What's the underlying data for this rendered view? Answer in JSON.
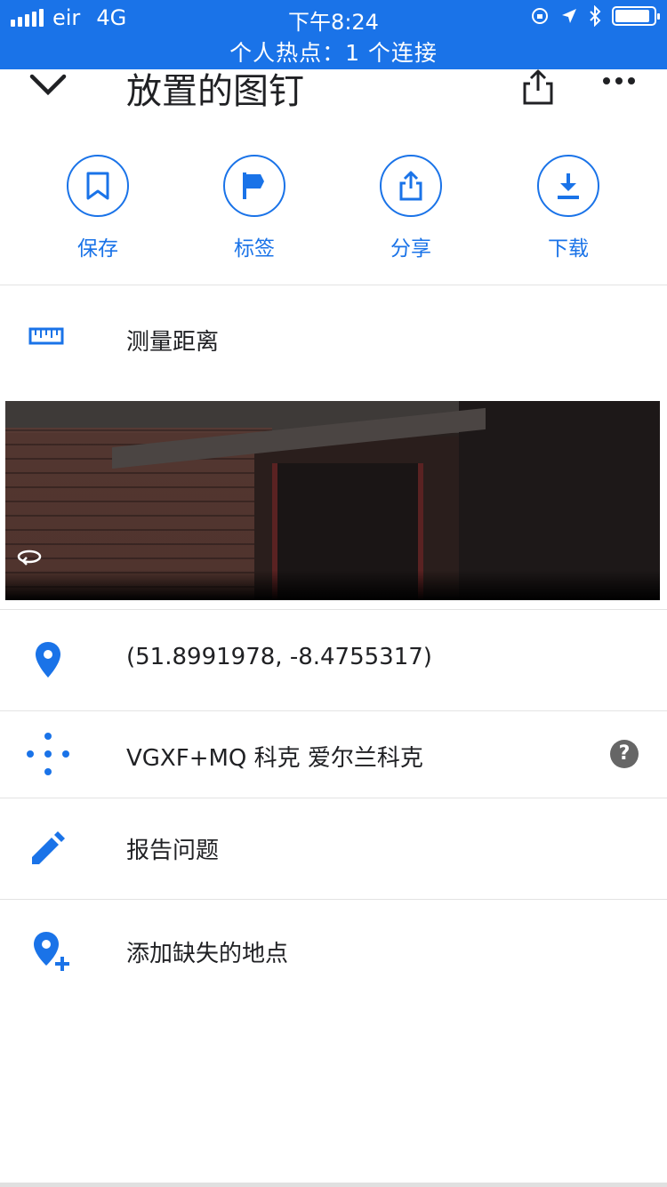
{
  "status_bar": {
    "carrier": "eir",
    "network": "4G",
    "time": "下午8:24",
    "hotspot": "个人热点：1 个连接",
    "bg_color": "#1a73e8"
  },
  "header": {
    "title": "放置的图钉"
  },
  "actions": [
    {
      "label": "保存",
      "icon": "bookmark-icon"
    },
    {
      "label": "标签",
      "icon": "flag-icon"
    },
    {
      "label": "分享",
      "icon": "share-icon"
    },
    {
      "label": "下载",
      "icon": "download-icon"
    }
  ],
  "measure": {
    "label": "测量距离",
    "icon": "ruler-icon"
  },
  "details": {
    "coordinates": "(51.8991978, -8.4755317)",
    "plus_code": "VGXF+MQ 科克 爱尔兰科克",
    "report": "报告问题",
    "add_place": "添加缺失的地点"
  },
  "accent_color": "#1a73e8"
}
